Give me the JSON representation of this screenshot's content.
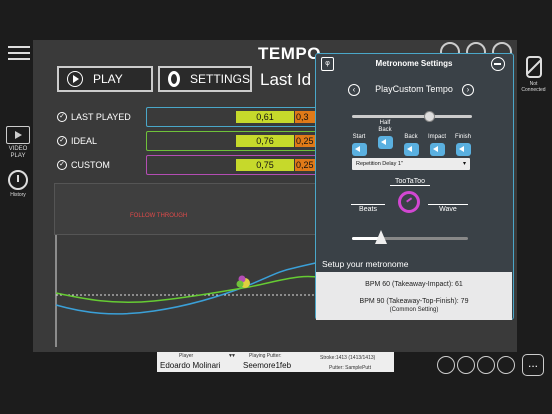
{
  "header": {
    "title": "TEMPO",
    "subtitle": "Last Id",
    "play_label": "PLAY",
    "settings_label": "SETTINGS"
  },
  "sidebar": {
    "video_play_label": "VIDEO PLAY",
    "history_label": "History"
  },
  "connection": {
    "status_label": "Not Connected"
  },
  "rows": [
    {
      "label": "LAST PLAYED",
      "value_a": "0,61",
      "value_b": "0,3",
      "color": "#4aa7c9"
    },
    {
      "label": "IDEAL",
      "value_a": "0,76",
      "value_b": "0,25",
      "color": "#6fc23a"
    },
    {
      "label": "CUSTOM",
      "value_a": "0,75",
      "value_b": "0,25",
      "color": "#b44db4"
    }
  ],
  "chart": {
    "annotation": "FOLLOW THROUGH",
    "series": [
      {
        "color": "#3aa0d8"
      },
      {
        "color": "#66cc33"
      }
    ]
  },
  "metronome": {
    "title": "Metronome Settings",
    "logo": "φ",
    "tempo_name": "PlayCustom Tempo",
    "sounds": [
      {
        "label_line1": "",
        "label_line2": "Start"
      },
      {
        "label_line1": "Half",
        "label_line2": "Back"
      },
      {
        "label_line1": "",
        "label_line2": "Back"
      },
      {
        "label_line1": "",
        "label_line2": "Impact"
      },
      {
        "label_line1": "",
        "label_line2": "Finish"
      }
    ],
    "repetition_select": "Repetition Delay 1\"",
    "modes": {
      "tootatoo": "TooTaToo",
      "beats": "Beats",
      "wave": "Wave"
    },
    "volume_level": 0.64,
    "tempo_level": 0.25,
    "setup_title": "Setup your metronome",
    "setup_line1": "BPM 60 (Takeaway-Impact): 61",
    "setup_line2": "BPM 90 (Takeaway-Top-Finish): 79",
    "setup_line3": "(Common Setting)"
  },
  "footer": {
    "player_label": "Player",
    "player_name": "Edoardo Molinari",
    "putter_label": "Playing Putter:",
    "putter_name": "Seemore1feb",
    "stroke_text": "Stroke:1413 (1413/1413)",
    "putter_model": "Putter: SamplePutt",
    "more_label": "..."
  }
}
